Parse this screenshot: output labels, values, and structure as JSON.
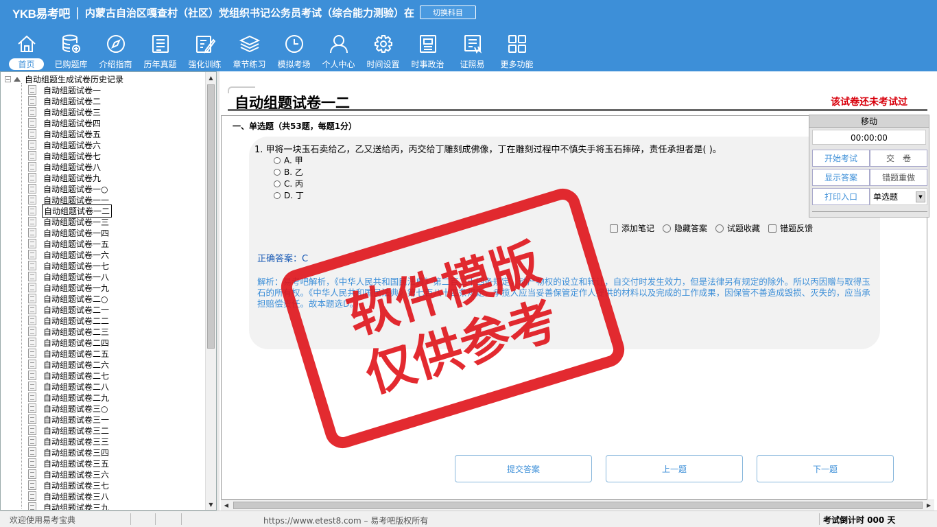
{
  "header": {
    "logo": "YKB易考吧",
    "title": "内蒙古自治区嘎查村（社区）党组织书记公务员考试（综合能力测验）在",
    "switch_subject": "切换科目"
  },
  "toolbar": [
    {
      "label": "首页",
      "icon": "home-icon"
    },
    {
      "label": "已购题库",
      "icon": "database-icon"
    },
    {
      "label": "介绍指南",
      "icon": "compass-icon"
    },
    {
      "label": "历年真题",
      "icon": "list-icon"
    },
    {
      "label": "强化训练",
      "icon": "edit-icon"
    },
    {
      "label": "章节练习",
      "icon": "layers-icon"
    },
    {
      "label": "模拟考场",
      "icon": "clock-icon"
    },
    {
      "label": "个人中心",
      "icon": "user-icon"
    },
    {
      "label": "时间设置",
      "icon": "gear-icon"
    },
    {
      "label": "时事政治",
      "icon": "news-icon"
    },
    {
      "label": "证照易",
      "icon": "certificate-icon"
    },
    {
      "label": "更多功能",
      "icon": "grid-icon"
    }
  ],
  "tree": {
    "root": "自动组题生成试卷历史记录",
    "items": [
      "自动组题试卷一",
      "自动组题试卷二",
      "自动组题试卷三",
      "自动组题试卷四",
      "自动组题试卷五",
      "自动组题试卷六",
      "自动组题试卷七",
      "自动组题试卷八",
      "自动组题试卷九",
      "自动组题试卷一○",
      "自动组题试卷一一",
      "自动组题试卷一二",
      "自动组题试卷一三",
      "自动组题试卷一四",
      "自动组题试卷一五",
      "自动组题试卷一六",
      "自动组题试卷一七",
      "自动组题试卷一八",
      "自动组题试卷一九",
      "自动组题试卷二○",
      "自动组题试卷二一",
      "自动组题试卷二二",
      "自动组题试卷二三",
      "自动组题试卷二四",
      "自动组题试卷二五",
      "自动组题试卷二六",
      "自动组题试卷二七",
      "自动组题试卷二八",
      "自动组题试卷二九",
      "自动组题试卷三○",
      "自动组题试卷三一",
      "自动组题试卷三二",
      "自动组题试卷三三",
      "自动组题试卷三四",
      "自动组题试卷三五",
      "自动组题试卷三六",
      "自动组题试卷三七",
      "自动组题试卷三八",
      "自动组题试卷三九"
    ],
    "selected_index": 11
  },
  "paper": {
    "title": "自动组题试卷一二",
    "status": "该试卷还未考试过",
    "section": "一、单选题（共53题，每题1分）",
    "question": "1. 甲将一块玉石卖给乙，乙又送给丙，丙交给丁雕刻成佛像，丁在雕刻过程中不慎失手将玉石摔碎，责任承担者是( )。",
    "options": [
      "A. 甲",
      "B. 乙",
      "C. 丙",
      "D. 丁"
    ],
    "actions": [
      "添加笔记",
      "隐藏答案",
      "试题收藏",
      "错题反馈"
    ],
    "correct_answer": "正确答案：C",
    "explanation": "解析：易考吧解析，《中华人民共和国民法典》第二百二十四条规定，动产物权的设立和转让，自交付时发生效力，但是法律另有规定的除外。所以丙因赠与取得玉石的所有权。《中华人民共和国民法典》第七百八十四条规定，承揽人应当妥善保管定作人提供的材料以及完成的工作成果，因保管不善造成毁损、灭失的，应当承担赔偿责任。故本题选D。",
    "stamp_line1": "软件模版",
    "stamp_line2": "仅供参考"
  },
  "nav": {
    "submit": "提交答案",
    "prev": "上一题",
    "next": "下一题"
  },
  "control": {
    "move": "移动",
    "timer": "00:00:00",
    "start_exam": "开始考试",
    "hand_in": "交　卷",
    "show_answer": "显示答案",
    "redo_wrong": "错题重做",
    "print": "打印入口",
    "question_type": "单选题"
  },
  "status": {
    "welcome": "欢迎使用易考宝典",
    "url": "https://www.etest8.com – 易考吧版权所有",
    "countdown": "考试倒计时 000 天"
  },
  "colors": {
    "header_blue": "#3d8fd8",
    "stamp_red": "#e0141a",
    "status_red": "#d8000c"
  }
}
